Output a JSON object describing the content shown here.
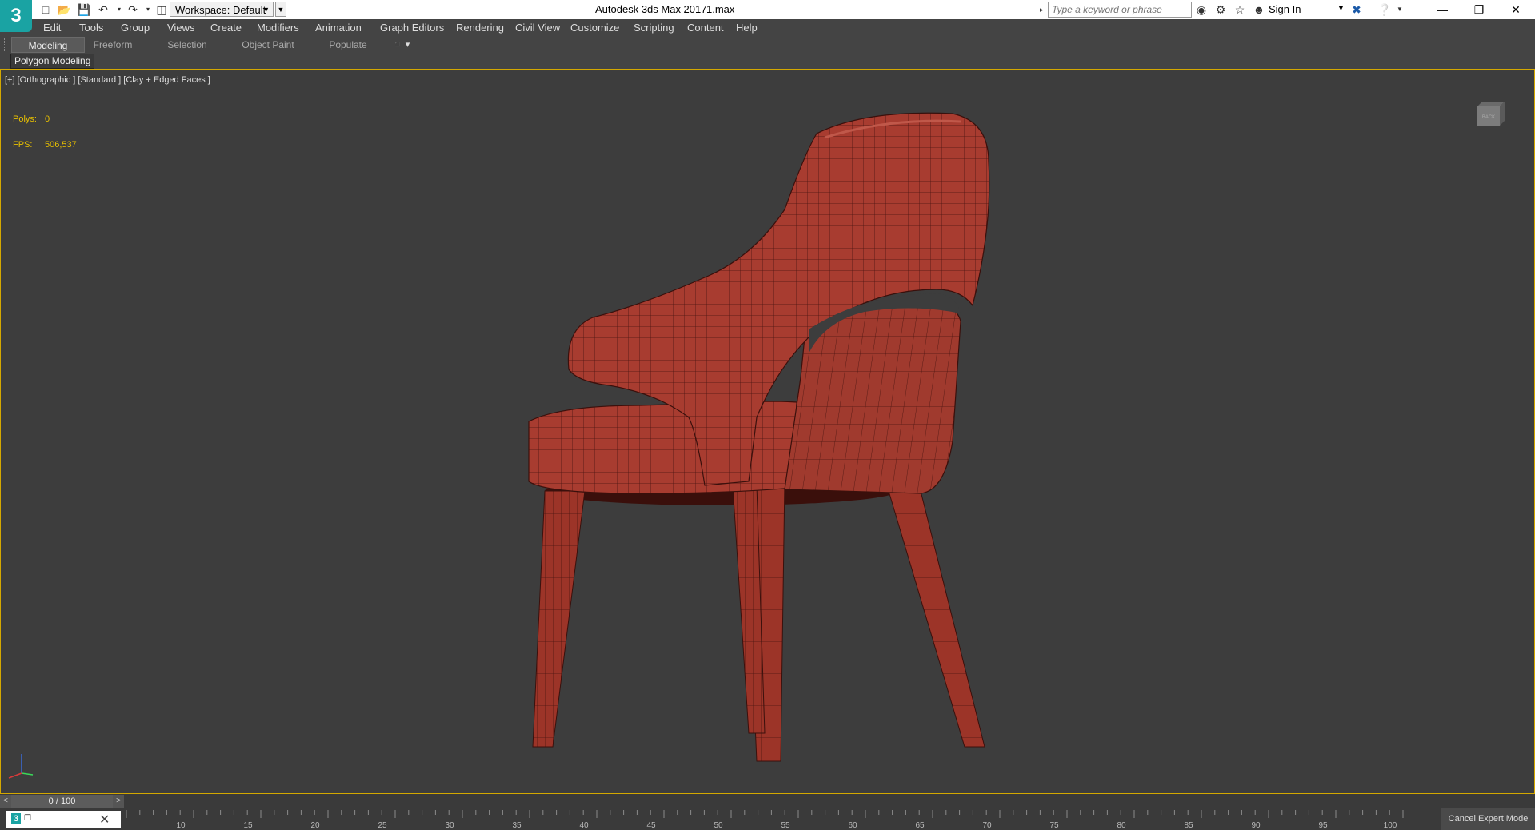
{
  "titlebar": {
    "app_logo": "3",
    "workspace_label": "Workspace: Default",
    "window_title": "Autodesk 3ds Max 2017",
    "file_name": "1.max",
    "search_placeholder": "Type a keyword or phrase",
    "sign_in_label": "Sign In",
    "quick_access_icons": [
      "new-file-icon",
      "open-file-icon",
      "save-icon",
      "undo-icon",
      "redo-icon",
      "project-folder-icon"
    ],
    "window_controls": [
      "minimize",
      "restore",
      "close"
    ]
  },
  "menubar": {
    "items": [
      "Edit",
      "Tools",
      "Group",
      "Views",
      "Create",
      "Modifiers",
      "Animation",
      "Graph Editors",
      "Rendering",
      "Civil View",
      "Customize",
      "Scripting",
      "Content",
      "Help"
    ]
  },
  "ribbon": {
    "tabs": [
      "Modeling",
      "Freeform",
      "Selection",
      "Object Paint",
      "Populate"
    ],
    "active_tab": "Modeling",
    "panel_label": "Polygon Modeling"
  },
  "viewport": {
    "label": "[+] [Orthographic ] [Standard ] [Clay + Edged Faces ]",
    "stats": {
      "polys_label": "Polys:",
      "polys_value": "0",
      "fps_label": "FPS:",
      "fps_value": "506,537"
    },
    "viewcube_face": "BACK",
    "model_color": "#a83c30",
    "border_color": "#d4a800"
  },
  "timeline": {
    "slider_text": "0 / 100",
    "prev_label": "<",
    "next_label": ">",
    "ticks": [
      "10",
      "15",
      "20",
      "25",
      "30",
      "35",
      "40",
      "45",
      "50",
      "55",
      "60",
      "65",
      "70",
      "75",
      "80",
      "85",
      "90",
      "95",
      "100"
    ]
  },
  "statusbar": {
    "cancel_expert_label": "Cancel Expert Mode"
  }
}
